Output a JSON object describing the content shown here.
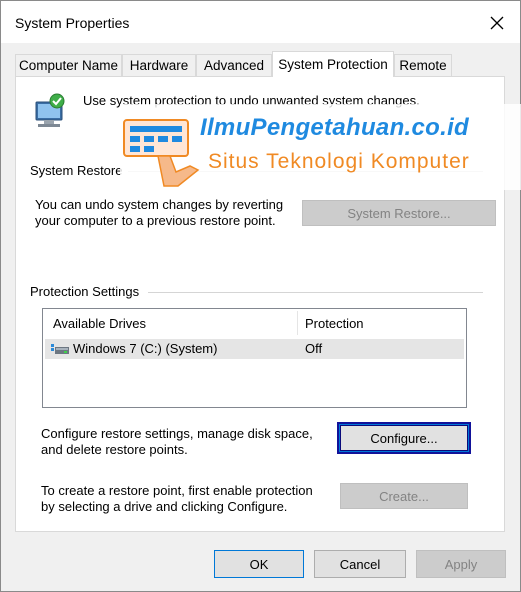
{
  "window": {
    "title": "System Properties"
  },
  "tabs": [
    {
      "label": "Computer Name"
    },
    {
      "label": "Hardware"
    },
    {
      "label": "Advanced"
    },
    {
      "label": "System Protection"
    },
    {
      "label": "Remote"
    }
  ],
  "protection": {
    "intro": "Use system protection to undo unwanted system changes.",
    "restore_group": "System Restore",
    "restore_text_1": "You can undo system changes by reverting",
    "restore_text_2": "your computer to a previous restore point.",
    "restore_button": "System Restore...",
    "settings_group": "Protection Settings",
    "drives": {
      "columns": [
        "Available Drives",
        "Protection"
      ],
      "rows": [
        {
          "drive": "Windows 7 (C:) (System)",
          "protection": "Off"
        }
      ]
    },
    "configure_text_1": "Configure restore settings, manage disk space,",
    "configure_text_2": "and delete restore points.",
    "configure_button": "Configure...",
    "create_text_1": "To create a restore point, first enable protection",
    "create_text_2": "by selecting a drive and clicking Configure.",
    "create_button": "Create..."
  },
  "footer": {
    "ok": "OK",
    "cancel": "Cancel",
    "apply": "Apply"
  },
  "watermark": {
    "title": "IlmuPengetahuan.co.id",
    "subtitle": "Situs Teknologi Komputer"
  },
  "colors": {
    "accent": "#0078d7",
    "watermark_blue": "#1f8ae0",
    "watermark_orange": "#f08a24"
  },
  "icons": {
    "close": "close-icon",
    "system": "computer-shield-icon",
    "drive": "hard-drive-icon"
  }
}
